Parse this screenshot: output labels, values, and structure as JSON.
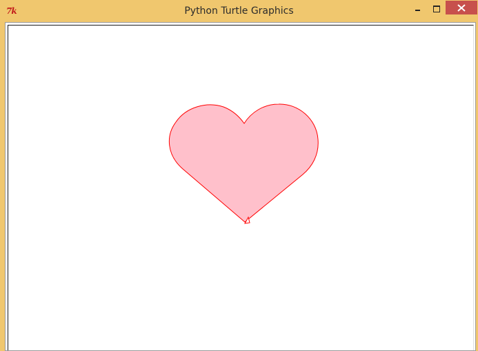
{
  "window": {
    "title": "Python Turtle Graphics",
    "app_icon": "tk-feather-icon",
    "app_icon_text": "7k",
    "controls": {
      "minimize_icon": "minimize-icon",
      "maximize_icon": "maximize-icon",
      "close_icon": "close-icon"
    },
    "titlebar_color": "#f0c76e",
    "close_button_color": "#c7504c"
  },
  "canvas": {
    "background": "#ffffff",
    "drawing": {
      "shape": "heart",
      "fill_color": "pink",
      "pen_color": "red",
      "turtle_icon": "turtle-arrow-icon"
    }
  }
}
